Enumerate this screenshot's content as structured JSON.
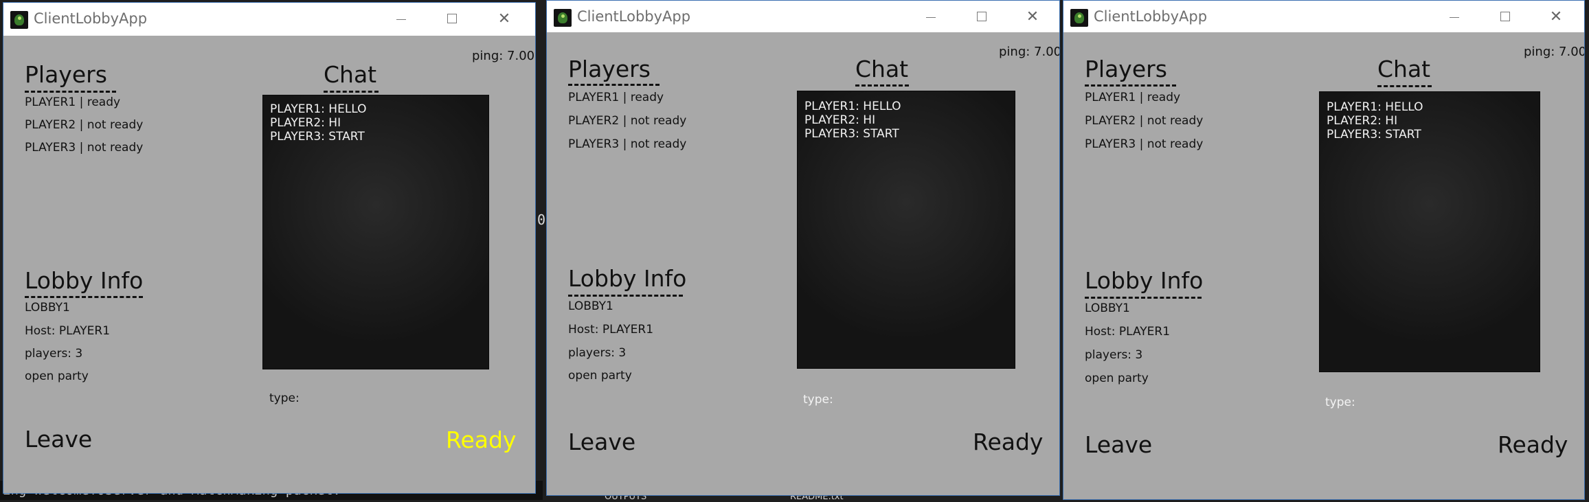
{
  "background": {
    "terminal_text": "ing WelcomeToServer and MatchMaking packet.",
    "stray_char": "0",
    "files": [
      "OUTPUTS",
      "README.txt"
    ]
  },
  "windows": [
    {
      "title": "ClientLobbyApp",
      "ping": "ping: 7.00",
      "players_heading": "Players",
      "players": [
        "PLAYER1 | ready",
        "PLAYER2 | not ready",
        "PLAYER3 | not ready"
      ],
      "chat_heading": "Chat",
      "chat_messages": [
        "PLAYER1: HELLO",
        "PLAYER2: HI",
        "PLAYER3: START"
      ],
      "lobby_heading": "Lobby Info",
      "lobby_lines": [
        "LOBBY1",
        "Host: PLAYER1",
        "players: 3",
        "open party"
      ],
      "type_label": "type:",
      "leave_label": "Leave",
      "ready_label": "Ready",
      "ready_color": "#ffff00",
      "type_color": "#111111"
    },
    {
      "title": "ClientLobbyApp",
      "ping": "ping: 7.00",
      "players_heading": "Players",
      "players": [
        "PLAYER1 | ready",
        "PLAYER2 | not ready",
        "PLAYER3 | not ready"
      ],
      "chat_heading": "Chat",
      "chat_messages": [
        "PLAYER1: HELLO",
        "PLAYER2: HI",
        "PLAYER3: START"
      ],
      "lobby_heading": "Lobby Info",
      "lobby_lines": [
        "LOBBY1",
        "Host: PLAYER1",
        "players: 3",
        "open party"
      ],
      "type_label": "type:",
      "leave_label": "Leave",
      "ready_label": "Ready",
      "ready_color": "#111111",
      "type_color": "#f4f4f4"
    },
    {
      "title": "ClientLobbyApp",
      "ping": "ping: 7.00",
      "players_heading": "Players",
      "players": [
        "PLAYER1 | ready",
        "PLAYER2 | not ready",
        "PLAYER3 | not ready"
      ],
      "chat_heading": "Chat",
      "chat_messages": [
        "PLAYER1: HELLO",
        "PLAYER2: HI",
        "PLAYER3: START"
      ],
      "lobby_heading": "Lobby Info",
      "lobby_lines": [
        "LOBBY1",
        "Host: PLAYER1",
        "players: 3",
        "open party"
      ],
      "type_label": "type:",
      "leave_label": "Leave",
      "ready_label": "Ready",
      "ready_color": "#111111",
      "type_color": "#f4f4f4"
    }
  ]
}
